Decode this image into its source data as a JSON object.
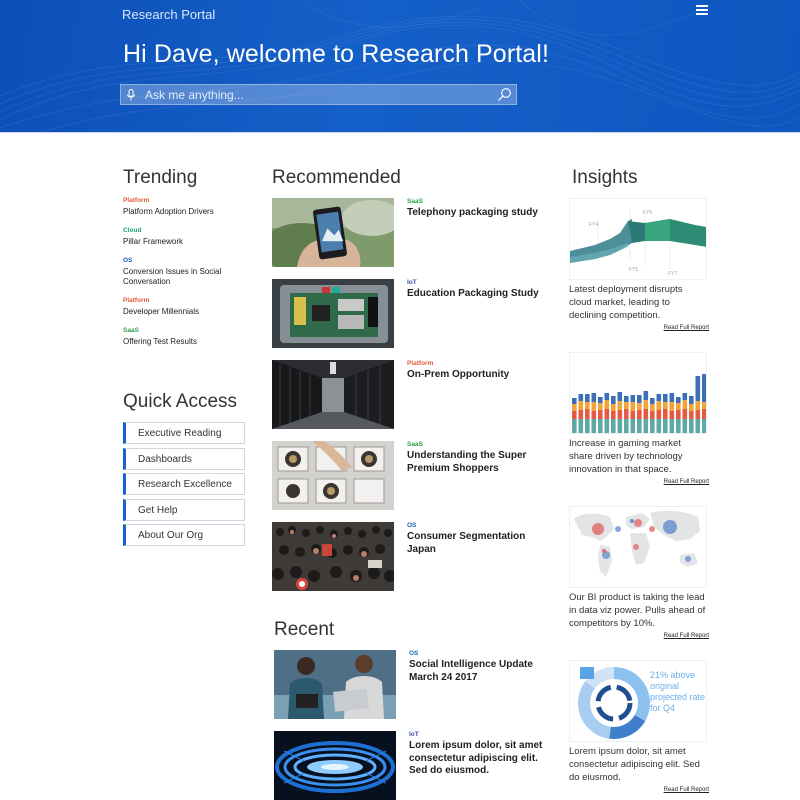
{
  "header": {
    "portal_name": "Research Portal",
    "welcome": "Hi Dave, welcome to Research Portal!",
    "search_placeholder": "Ask me anything..."
  },
  "colors": {
    "platform": "#e55a3c",
    "cloud": "#1aa36b",
    "os": "#1f5fb4",
    "saas": "#2e9e4b",
    "iot": "#3f4db0",
    "accent": "#1565c8"
  },
  "trending": {
    "title": "Trending",
    "items": [
      {
        "tag": "Platform",
        "title": "Platform Adoption Drivers"
      },
      {
        "tag": "Cloud",
        "title": "Pillar Framework"
      },
      {
        "tag": "OS",
        "title": "Conversion Issues in Social Conversation"
      },
      {
        "tag": "Platform",
        "title": "Developer Millennials"
      },
      {
        "tag": "SaaS",
        "title": "Offering Test Results"
      }
    ]
  },
  "quick_access": {
    "title": "Quick Access",
    "items": [
      "Executive Reading",
      "Dashboards",
      "Research Excellence",
      "Get Help",
      "About Our Org"
    ]
  },
  "recommended": {
    "title": "Recommended",
    "items": [
      {
        "tag": "SaaS",
        "title": "Telephony packaging study",
        "image": "phone-in-hand-photo"
      },
      {
        "tag": "IoT",
        "title": "Education Packaging Study",
        "image": "circuit-board-photo"
      },
      {
        "tag": "Platform",
        "title": "On-Prem Opportunity",
        "image": "server-room-photo"
      },
      {
        "tag": "SaaS",
        "title": "Understanding the Super Premium Shoppers",
        "image": "watches-display-photo"
      },
      {
        "tag": "OS",
        "title": "Consumer Segmentation Japan",
        "image": "crowd-photo"
      }
    ]
  },
  "recent": {
    "title": "Recent",
    "items": [
      {
        "tag": "OS",
        "title": "Social Intelligence Update March 24 2017",
        "image": "people-with-laptops-photo"
      },
      {
        "tag": "IoT",
        "title": "Lorem ipsum dolor, sit amet consectetur adipiscing elit. Sed do eiusmod.",
        "image": "blue-light-tunnel-photo"
      }
    ]
  },
  "insights": {
    "title": "Insights",
    "read_label": "Read Full Report",
    "items": [
      {
        "caption": "Latest deployment disrupts cloud market, leading to declining competition.",
        "visual": "ribbon-chart",
        "labels": [
          "FY4",
          "FY6",
          "FY5",
          "FY7"
        ]
      },
      {
        "caption": "Increase in gaming market share driven by technology innovation in that space.",
        "visual": "stacked-bar-chart"
      },
      {
        "caption": "Our BI product is taking the lead in data viz power. Pulls ahead of competitors by 10%.",
        "visual": "bubble-map"
      },
      {
        "caption": "Lorem ipsum dolor, sit amet consectetur adipiscing elit. Sed do eiusmod.",
        "visual": "donut-chart",
        "callout": "21% above original projected rate for Q4"
      }
    ]
  }
}
